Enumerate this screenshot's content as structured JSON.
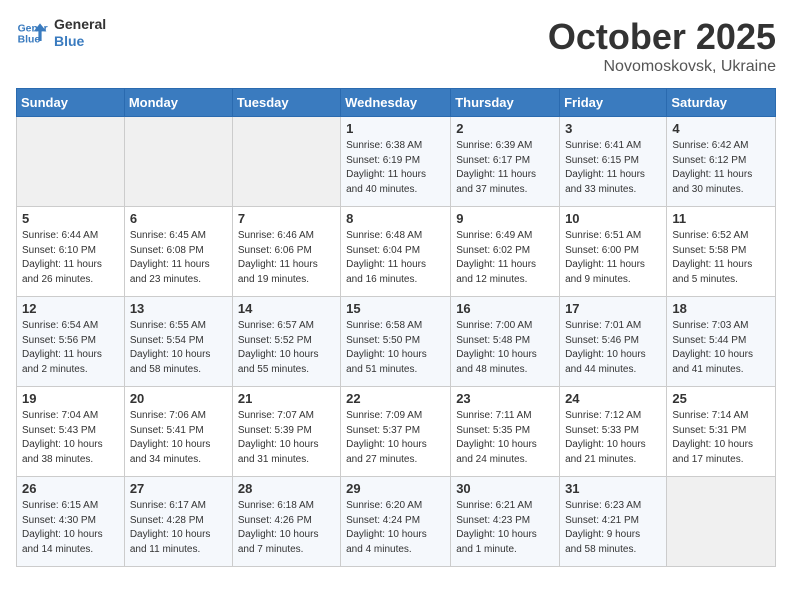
{
  "header": {
    "logo_line1": "General",
    "logo_line2": "Blue",
    "month": "October 2025",
    "location": "Novomoskovsk, Ukraine"
  },
  "weekdays": [
    "Sunday",
    "Monday",
    "Tuesday",
    "Wednesday",
    "Thursday",
    "Friday",
    "Saturday"
  ],
  "weeks": [
    [
      {
        "day": "",
        "info": ""
      },
      {
        "day": "",
        "info": ""
      },
      {
        "day": "",
        "info": ""
      },
      {
        "day": "1",
        "info": "Sunrise: 6:38 AM\nSunset: 6:19 PM\nDaylight: 11 hours\nand 40 minutes."
      },
      {
        "day": "2",
        "info": "Sunrise: 6:39 AM\nSunset: 6:17 PM\nDaylight: 11 hours\nand 37 minutes."
      },
      {
        "day": "3",
        "info": "Sunrise: 6:41 AM\nSunset: 6:15 PM\nDaylight: 11 hours\nand 33 minutes."
      },
      {
        "day": "4",
        "info": "Sunrise: 6:42 AM\nSunset: 6:12 PM\nDaylight: 11 hours\nand 30 minutes."
      }
    ],
    [
      {
        "day": "5",
        "info": "Sunrise: 6:44 AM\nSunset: 6:10 PM\nDaylight: 11 hours\nand 26 minutes."
      },
      {
        "day": "6",
        "info": "Sunrise: 6:45 AM\nSunset: 6:08 PM\nDaylight: 11 hours\nand 23 minutes."
      },
      {
        "day": "7",
        "info": "Sunrise: 6:46 AM\nSunset: 6:06 PM\nDaylight: 11 hours\nand 19 minutes."
      },
      {
        "day": "8",
        "info": "Sunrise: 6:48 AM\nSunset: 6:04 PM\nDaylight: 11 hours\nand 16 minutes."
      },
      {
        "day": "9",
        "info": "Sunrise: 6:49 AM\nSunset: 6:02 PM\nDaylight: 11 hours\nand 12 minutes."
      },
      {
        "day": "10",
        "info": "Sunrise: 6:51 AM\nSunset: 6:00 PM\nDaylight: 11 hours\nand 9 minutes."
      },
      {
        "day": "11",
        "info": "Sunrise: 6:52 AM\nSunset: 5:58 PM\nDaylight: 11 hours\nand 5 minutes."
      }
    ],
    [
      {
        "day": "12",
        "info": "Sunrise: 6:54 AM\nSunset: 5:56 PM\nDaylight: 11 hours\nand 2 minutes."
      },
      {
        "day": "13",
        "info": "Sunrise: 6:55 AM\nSunset: 5:54 PM\nDaylight: 10 hours\nand 58 minutes."
      },
      {
        "day": "14",
        "info": "Sunrise: 6:57 AM\nSunset: 5:52 PM\nDaylight: 10 hours\nand 55 minutes."
      },
      {
        "day": "15",
        "info": "Sunrise: 6:58 AM\nSunset: 5:50 PM\nDaylight: 10 hours\nand 51 minutes."
      },
      {
        "day": "16",
        "info": "Sunrise: 7:00 AM\nSunset: 5:48 PM\nDaylight: 10 hours\nand 48 minutes."
      },
      {
        "day": "17",
        "info": "Sunrise: 7:01 AM\nSunset: 5:46 PM\nDaylight: 10 hours\nand 44 minutes."
      },
      {
        "day": "18",
        "info": "Sunrise: 7:03 AM\nSunset: 5:44 PM\nDaylight: 10 hours\nand 41 minutes."
      }
    ],
    [
      {
        "day": "19",
        "info": "Sunrise: 7:04 AM\nSunset: 5:43 PM\nDaylight: 10 hours\nand 38 minutes."
      },
      {
        "day": "20",
        "info": "Sunrise: 7:06 AM\nSunset: 5:41 PM\nDaylight: 10 hours\nand 34 minutes."
      },
      {
        "day": "21",
        "info": "Sunrise: 7:07 AM\nSunset: 5:39 PM\nDaylight: 10 hours\nand 31 minutes."
      },
      {
        "day": "22",
        "info": "Sunrise: 7:09 AM\nSunset: 5:37 PM\nDaylight: 10 hours\nand 27 minutes."
      },
      {
        "day": "23",
        "info": "Sunrise: 7:11 AM\nSunset: 5:35 PM\nDaylight: 10 hours\nand 24 minutes."
      },
      {
        "day": "24",
        "info": "Sunrise: 7:12 AM\nSunset: 5:33 PM\nDaylight: 10 hours\nand 21 minutes."
      },
      {
        "day": "25",
        "info": "Sunrise: 7:14 AM\nSunset: 5:31 PM\nDaylight: 10 hours\nand 17 minutes."
      }
    ],
    [
      {
        "day": "26",
        "info": "Sunrise: 6:15 AM\nSunset: 4:30 PM\nDaylight: 10 hours\nand 14 minutes."
      },
      {
        "day": "27",
        "info": "Sunrise: 6:17 AM\nSunset: 4:28 PM\nDaylight: 10 hours\nand 11 minutes."
      },
      {
        "day": "28",
        "info": "Sunrise: 6:18 AM\nSunset: 4:26 PM\nDaylight: 10 hours\nand 7 minutes."
      },
      {
        "day": "29",
        "info": "Sunrise: 6:20 AM\nSunset: 4:24 PM\nDaylight: 10 hours\nand 4 minutes."
      },
      {
        "day": "30",
        "info": "Sunrise: 6:21 AM\nSunset: 4:23 PM\nDaylight: 10 hours\nand 1 minute."
      },
      {
        "day": "31",
        "info": "Sunrise: 6:23 AM\nSunset: 4:21 PM\nDaylight: 9 hours\nand 58 minutes."
      },
      {
        "day": "",
        "info": ""
      }
    ]
  ]
}
